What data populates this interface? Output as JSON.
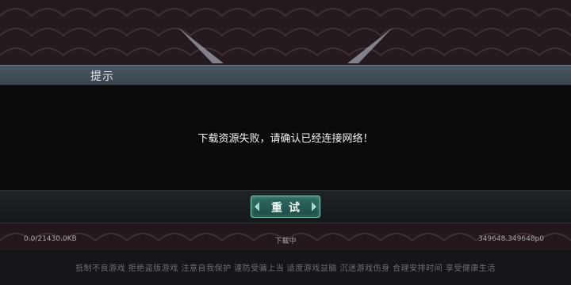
{
  "dialog": {
    "title": "提示",
    "message": "下载资源失败，请确认已经连接网络！",
    "retry_label": "重试"
  },
  "status": {
    "progress": "0.0/21430.0KB",
    "state": "下载中",
    "version": "349648.349648p0"
  },
  "health_notice": "抵制不良游戏 拒绝盗版游戏 注意自我保护 谨防受骗上当 适度游戏益脑 沉迷游戏伤身 合理安排时间 享受健康生活",
  "colors": {
    "header": "#46505c",
    "button": "#24594f",
    "button_border": "#7fc9b4"
  }
}
